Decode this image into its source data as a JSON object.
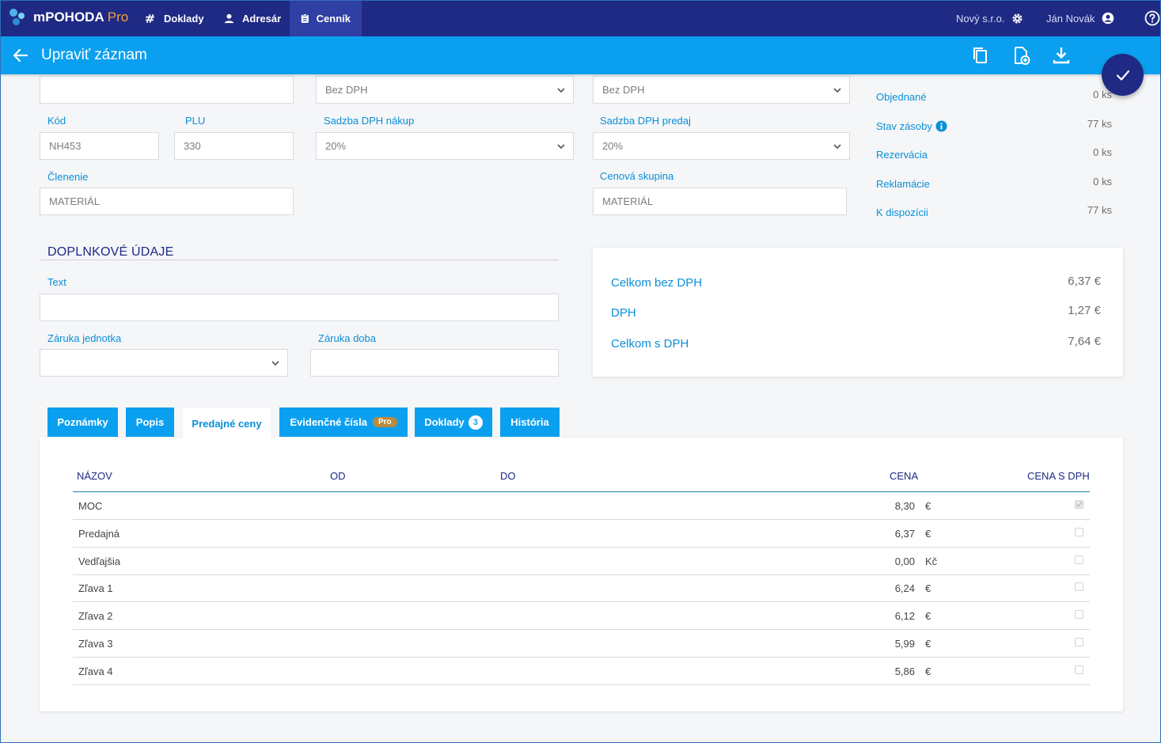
{
  "nav": {
    "brand": "mPOHODA",
    "brand_pro": "Pro",
    "items": [
      {
        "label": "Doklady",
        "icon": "documents-icon"
      },
      {
        "label": "Adresár",
        "icon": "person-icon"
      },
      {
        "label": "Cenník",
        "icon": "clipboard-icon"
      }
    ],
    "company": "Nový s.r.o.",
    "user": "Ján Novák"
  },
  "header": {
    "title": "Upraviť záznam"
  },
  "form": {
    "top_left_value": "",
    "top_mid_select": "Bez DPH",
    "top_right_select": "Bez DPH",
    "kod_label": "Kód",
    "kod_value": "NH453",
    "plu_label": "PLU",
    "plu_value": "330",
    "vat_buy_label": "Sadzba DPH nákup",
    "vat_buy_value": "20%",
    "vat_sell_label": "Sadzba DPH predaj",
    "vat_sell_value": "20%",
    "clenenie_label": "Členenie",
    "clenenie_value": "MATERIÁL",
    "price_group_label": "Cenová skupina",
    "price_group_value": "MATERIÁL",
    "section_title": "DOPLNKOVÉ ÚDAJE",
    "text_label": "Text",
    "text_value": "",
    "warranty_unit_label": "Záruka jednotka",
    "warranty_unit_value": "",
    "warranty_period_label": "Záruka doba",
    "warranty_period_value": ""
  },
  "stock": [
    {
      "label": "Objednané",
      "value": "0 ks"
    },
    {
      "label": "Stav zásoby",
      "value": "77 ks"
    },
    {
      "label": "Rezervácia",
      "value": "0 ks"
    },
    {
      "label": "Reklamácie",
      "value": "0 ks"
    },
    {
      "label": "K dispozícii",
      "value": "77 ks"
    }
  ],
  "totals": [
    {
      "label": "Celkom bez DPH",
      "value": "6,37 €"
    },
    {
      "label": "DPH",
      "value": "1,27 €"
    },
    {
      "label": "Celkom s DPH",
      "value": "7,64 €"
    }
  ],
  "tabs": [
    {
      "label": "Poznámky"
    },
    {
      "label": "Popis"
    },
    {
      "label": "Predajné ceny"
    },
    {
      "label": "Evidenčné čísla",
      "badge": "Pro"
    },
    {
      "label": "Doklady",
      "badge": "3"
    },
    {
      "label": "História"
    }
  ],
  "table": {
    "headers": [
      "NÁZOV",
      "OD",
      "DO",
      "CENA",
      "CENA S DPH"
    ],
    "rows": [
      {
        "name": "MOC",
        "price": "8,30",
        "currency": "€",
        "with_vat": true
      },
      {
        "name": "Predajná",
        "price": "6,37",
        "currency": "€",
        "with_vat": false
      },
      {
        "name": "Vedľajšia",
        "price": "0,00",
        "currency": "Kč",
        "with_vat": false
      },
      {
        "name": "Zľava 1",
        "price": "6,24",
        "currency": "€",
        "with_vat": false
      },
      {
        "name": "Zľava 2",
        "price": "6,12",
        "currency": "€",
        "with_vat": false
      },
      {
        "name": "Zľava 3",
        "price": "5,99",
        "currency": "€",
        "with_vat": false
      },
      {
        "name": "Zľava 4",
        "price": "5,86",
        "currency": "€",
        "with_vat": false
      }
    ]
  },
  "colors": {
    "nav": "#1f2a85",
    "header": "#0ba0ef",
    "label": "#0a8fd6",
    "pro": "#f0a13a"
  }
}
